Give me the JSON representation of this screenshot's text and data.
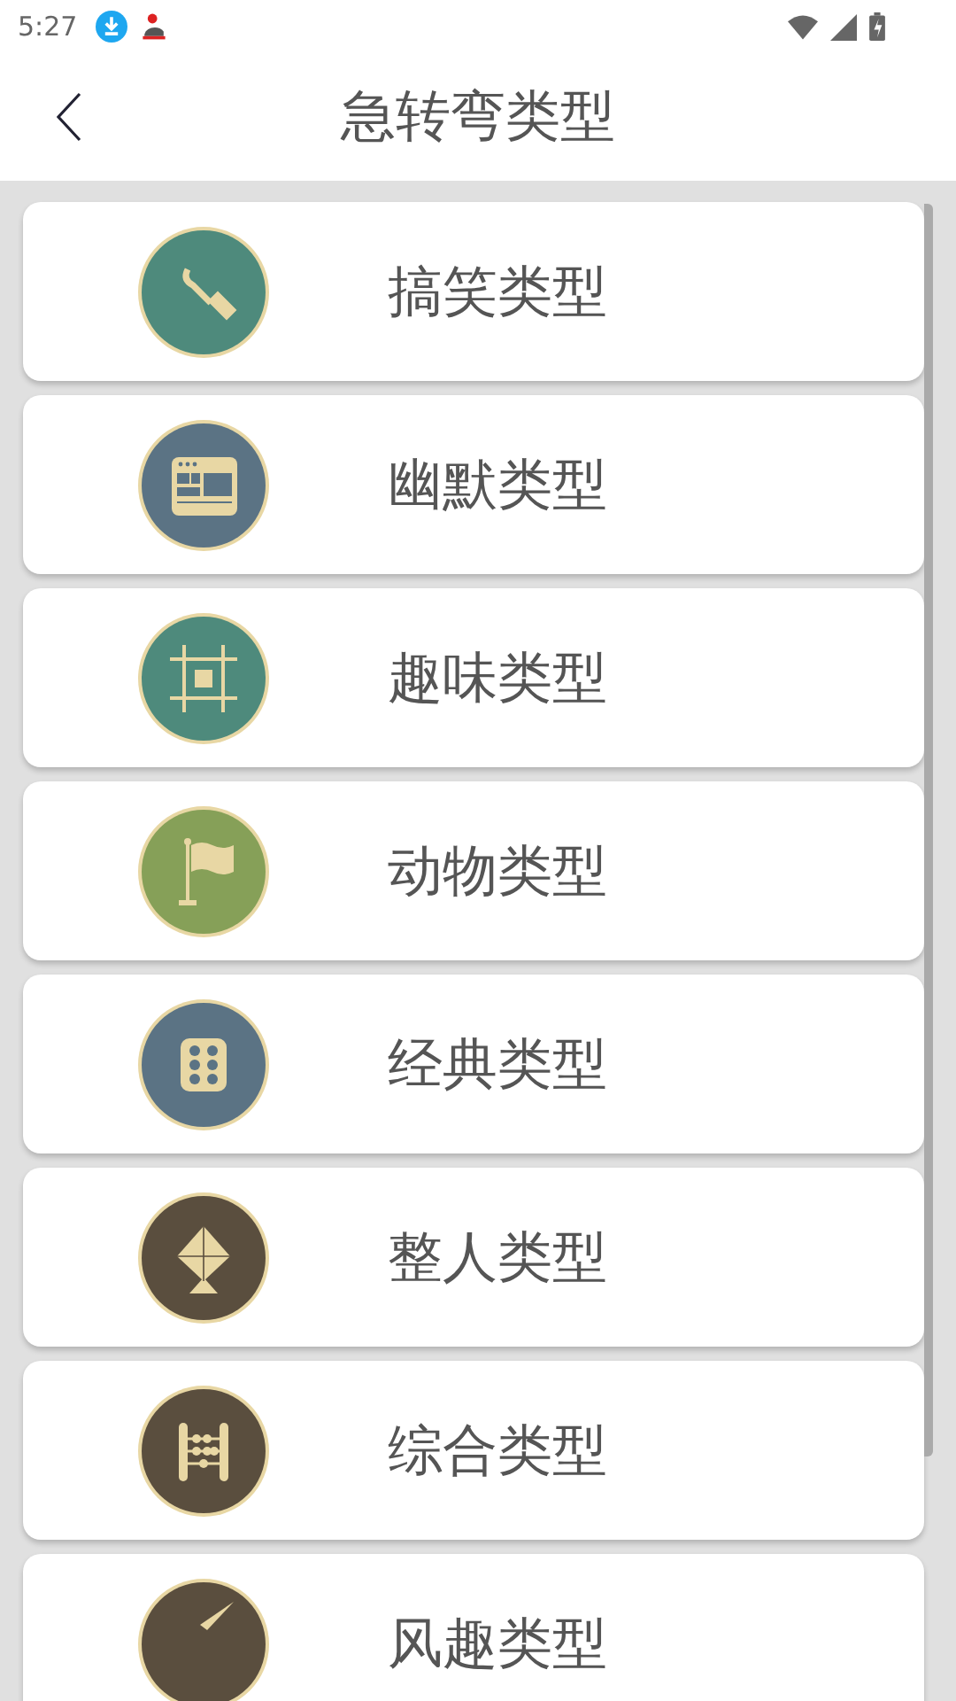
{
  "status_bar": {
    "time": "5:27"
  },
  "header": {
    "title": "急转弯类型"
  },
  "categories": [
    {
      "label": "搞笑类型",
      "kind": "wrench",
      "color": "#4e8a7c"
    },
    {
      "label": "幽默类型",
      "kind": "browser",
      "color": "#5b7384"
    },
    {
      "label": "趣味类型",
      "kind": "crop",
      "color": "#4e8a7c"
    },
    {
      "label": "动物类型",
      "kind": "flag",
      "color": "#86a058"
    },
    {
      "label": "经典类型",
      "kind": "dice",
      "color": "#5b7384"
    },
    {
      "label": "整人类型",
      "kind": "kite",
      "color": "#5a4e3e"
    },
    {
      "label": "综合类型",
      "kind": "abacus",
      "color": "#5a4e3e"
    },
    {
      "label": "风趣类型",
      "kind": "pen",
      "color": "#5a4e3e"
    }
  ]
}
